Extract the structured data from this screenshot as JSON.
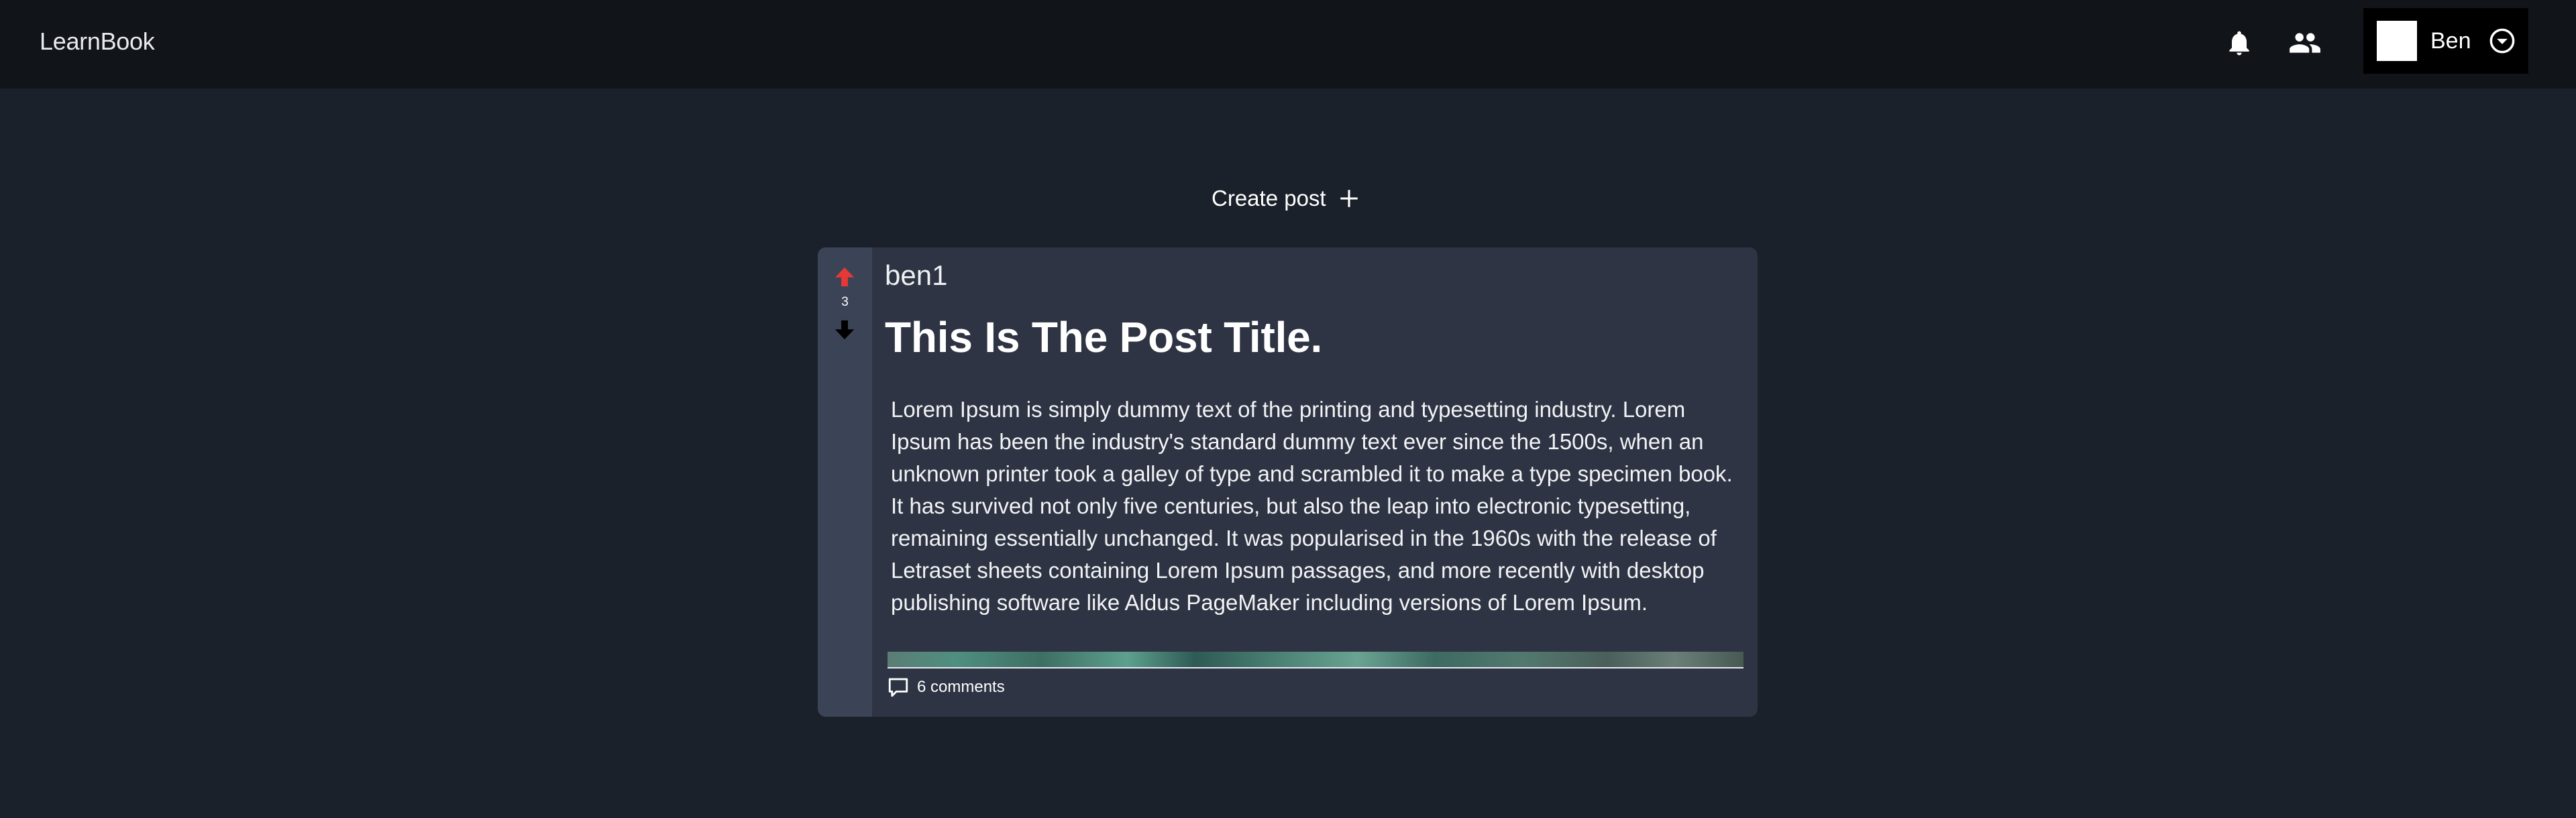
{
  "app": {
    "brand": "LearnBook"
  },
  "header": {
    "icons": {
      "notifications": "bell-icon",
      "friends": "people-icon",
      "menu": "chevron-down-circle-icon"
    },
    "user": {
      "name": "Ben"
    }
  },
  "main": {
    "create_post_label": "Create post",
    "create_post_icon": "plus-icon"
  },
  "post": {
    "author": "ben1",
    "title": "This Is The Post Title.",
    "body": "Lorem Ipsum is simply dummy text of the printing and typesetting industry. Lorem Ipsum has been the industry's standard dummy text ever since the 1500s, when an unknown printer took a galley of type and scrambled it to make a type specimen book. It has survived not only five centuries, but also the leap into electronic typesetting, remaining essentially unchanged. It was popularised in the 1960s with the release of Letraset sheets containing Lorem Ipsum passages, and more recently with desktop publishing software like Aldus PageMaker including versions of Lorem Ipsum.",
    "votes": "3",
    "comments_label": "6 comments"
  },
  "colors": {
    "background": "#1b212b",
    "topbar": "#111419",
    "card": "#2e3443",
    "vote_column": "#3b4356",
    "upvote_active": "#e53935",
    "downvote": "#000000"
  }
}
